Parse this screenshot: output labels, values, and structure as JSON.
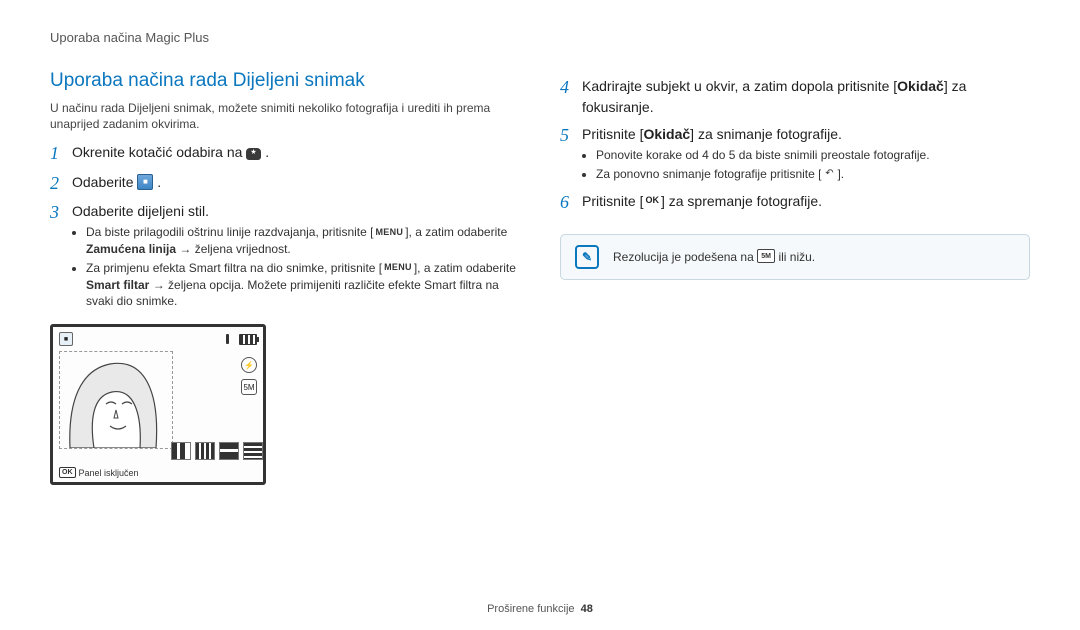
{
  "header": {
    "running": "Uporaba načina Magic Plus"
  },
  "section": {
    "title": "Uporaba načina rada Dijeljeni snimak",
    "intro": "U načinu rada Dijeljeni snimak, možete snimiti nekoliko fotografija i urediti ih prema unaprijed zadanim okvirima."
  },
  "left_steps": {
    "s1": {
      "num": "1",
      "text_before": "Okrenite kotačić odabira na ",
      "text_after": "."
    },
    "s2": {
      "num": "2",
      "text_before": "Odaberite ",
      "text_after": "."
    },
    "s3": {
      "num": "3",
      "text": "Odaberite dijeljeni stil.",
      "bullets": {
        "b1_a": "Da biste prilagodili oštrinu linije razdvajanja, pritisnite [",
        "b1_b": "], a zatim odaberite ",
        "b1_bold": "Zamućena linija",
        "b1_c": " → željena vrijednost.",
        "b2_a": "Za primjenu efekta Smart filtra na dio snimke, pritisnite [",
        "b2_b": "], a zatim odaberite ",
        "b2_bold": "Smart filtar",
        "b2_c": " → željena opcija. Možete primijeniti različite efekte Smart filtra na svaki dio snimke."
      }
    }
  },
  "right_steps": {
    "s4": {
      "num": "4",
      "text_a": "Kadrirajte subjekt u okvir, a zatim dopola pritisnite [",
      "bold": "Okidač",
      "text_b": "] za fokusiranje."
    },
    "s5": {
      "num": "5",
      "text_a": "Pritisnite [",
      "bold": "Okidač",
      "text_b": "] za snimanje fotografije.",
      "bullets": {
        "b1": "Ponovite korake od 4 do 5 da biste snimili preostale fotografije.",
        "b2_a": "Za ponovno snimanje fotografije pritisnite [",
        "b2_b": "]."
      }
    },
    "s6": {
      "num": "6",
      "text_a": "Pritisnite [",
      "text_b": "] za spremanje fotografije."
    }
  },
  "note": {
    "text_a": "Rezolucija je podešena na ",
    "text_b": " ili nižu."
  },
  "lcd": {
    "panel_label": "Panel isključen"
  },
  "icons": {
    "menu": "MENU",
    "ok": "OK",
    "back": "↶",
    "res5m": "5M",
    "note_mark": "✎",
    "flash": "⚡",
    "mode": "■"
  },
  "footer": {
    "section": "Proširene funkcije",
    "page": "48"
  }
}
